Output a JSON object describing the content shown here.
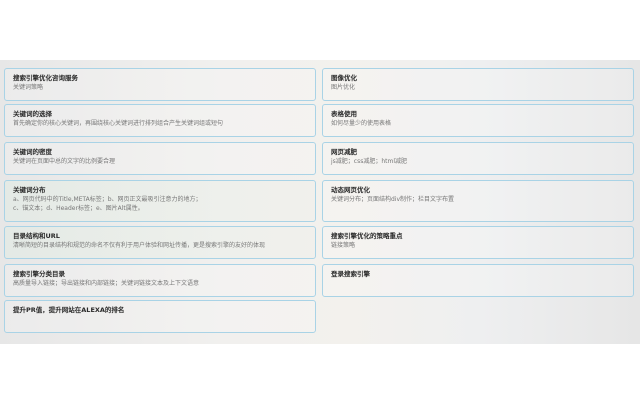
{
  "cards": [
    {
      "title": "搜索引擎优化咨询服务",
      "lines": [
        "关键词策略"
      ]
    },
    {
      "title": "图像优化",
      "lines": [
        "图片优化"
      ]
    },
    {
      "title": "关键词的选择",
      "lines": [
        "首先确定你的核心关键词，再围绕核心关键词进行排列组合产生关键词组或短句"
      ]
    },
    {
      "title": "表格使用",
      "lines": [
        "如何尽量少的使用表格"
      ]
    },
    {
      "title": "关键词的密度",
      "lines": [
        "关键词在页面中总的文字的比例要合理"
      ]
    },
    {
      "title": "网页减肥",
      "lines": [
        "js减肥；css减肥；html减肥"
      ]
    },
    {
      "title": "关键词分布",
      "lines": [
        "a、网页代码中的Title,META标签；b、网页正文最吸引注意力的地方；",
        "c、锚文本；d、Header标签；e、图片Alt属性。"
      ]
    },
    {
      "title": "动态网页优化",
      "lines": [
        "关键词分布；页面结构div制作；栏目文字布置"
      ]
    },
    {
      "title": "目录结构和URL",
      "lines": [
        "清晰简短的目录结构和规范的命名不仅有利于用户体验和网址传播，更是搜索引擎的友好的体现"
      ]
    },
    {
      "title": "搜索引擎优化的策略重点",
      "lines": [
        "链接策略"
      ]
    },
    {
      "title": "搜索引擎分类目录",
      "lines": [
        "高质量导入链接；导出链接和内部链接；关键词链接文本及上下文语意"
      ]
    },
    {
      "title": "登录搜索引擎",
      "lines": []
    },
    {
      "title": "提升PR值，提升网站在ALEXA的排名",
      "lines": []
    }
  ]
}
